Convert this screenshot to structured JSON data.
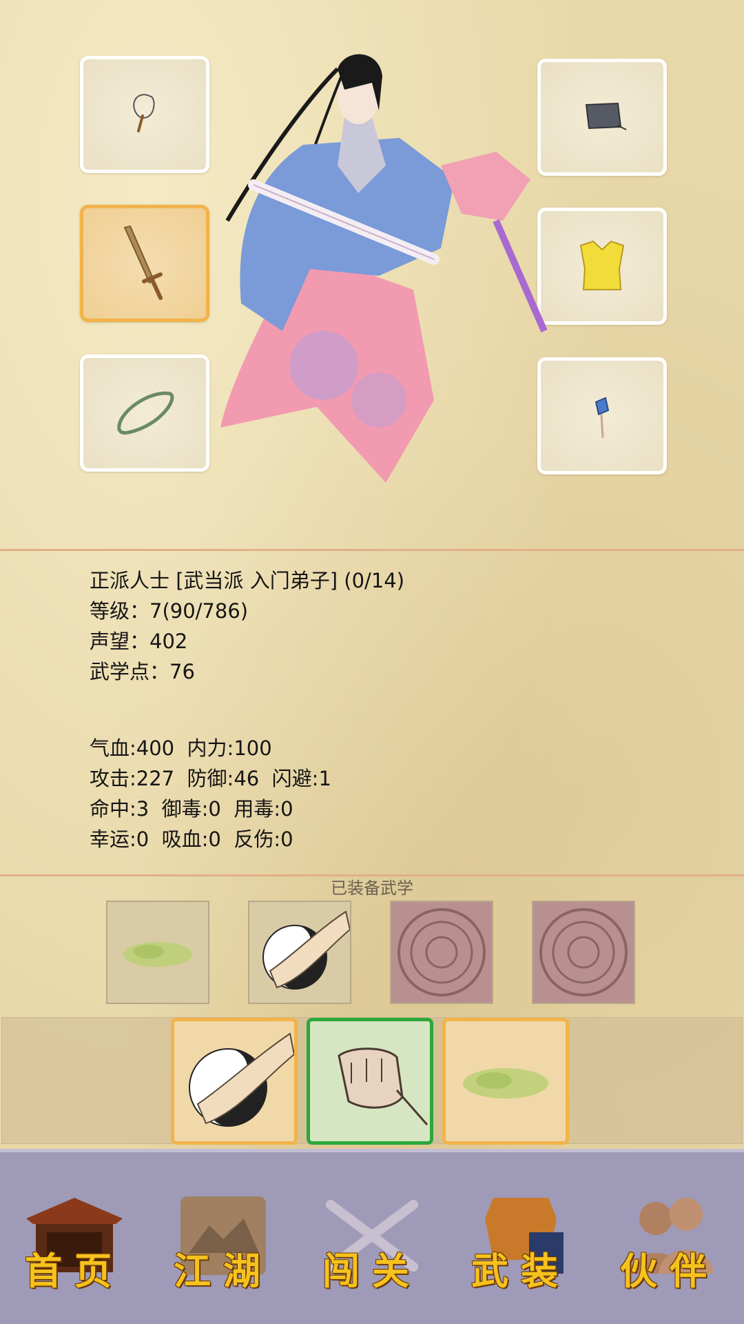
{
  "equipment": {
    "left_slots": [
      {
        "name": "whisk-icon",
        "selected": false
      },
      {
        "name": "sword-icon",
        "selected": true
      },
      {
        "name": "jade-bracelet-icon",
        "selected": false
      }
    ],
    "right_slots": [
      {
        "name": "cap-icon",
        "selected": false
      },
      {
        "name": "armor-vest-icon",
        "selected": false
      },
      {
        "name": "pendant-icon",
        "selected": false
      }
    ]
  },
  "character": {
    "title_line": "正派人士 [武当派 入门弟子] (0/14)",
    "level_line": "等级：7(90/786)",
    "reputation_line": "声望：402",
    "martial_points_line": "武学点：76"
  },
  "stats": {
    "line1": "气血:400  内力:100",
    "line2": "攻击:227  防御:46  闪避:1",
    "line3": "命中:3  御毒:0  用毒:0",
    "line4": "幸运:0  吸血:0  反伤:0"
  },
  "equipped_skills": {
    "label": "已装备武学",
    "items": [
      {
        "name": "green-moss-skill-icon",
        "style": "paper"
      },
      {
        "name": "taiji-palm-skill-icon",
        "style": "paper"
      },
      {
        "name": "empty-seal-slot-icon",
        "style": "stone"
      },
      {
        "name": "empty-seal-slot-icon",
        "style": "stone"
      }
    ]
  },
  "skill_bar": [
    {
      "name": "taiji-palm-skill-icon",
      "active": false
    },
    {
      "name": "fist-skill-icon",
      "active": true
    },
    {
      "name": "green-moss-skill-icon",
      "active": false
    }
  ],
  "nav": [
    {
      "label": "首页",
      "icon": "pavilion-icon"
    },
    {
      "label": "江湖",
      "icon": "scroll-map-icon"
    },
    {
      "label": "闯关",
      "icon": "crossed-swords-icon"
    },
    {
      "label": "武装",
      "icon": "armor-book-icon"
    },
    {
      "label": "伙伴",
      "icon": "companions-icon"
    }
  ],
  "colors": {
    "accent_orange": "#f2b34a",
    "active_green": "#2aa83a",
    "nav_gold": "#f6c21c",
    "nav_background": "#9e9ab8"
  }
}
